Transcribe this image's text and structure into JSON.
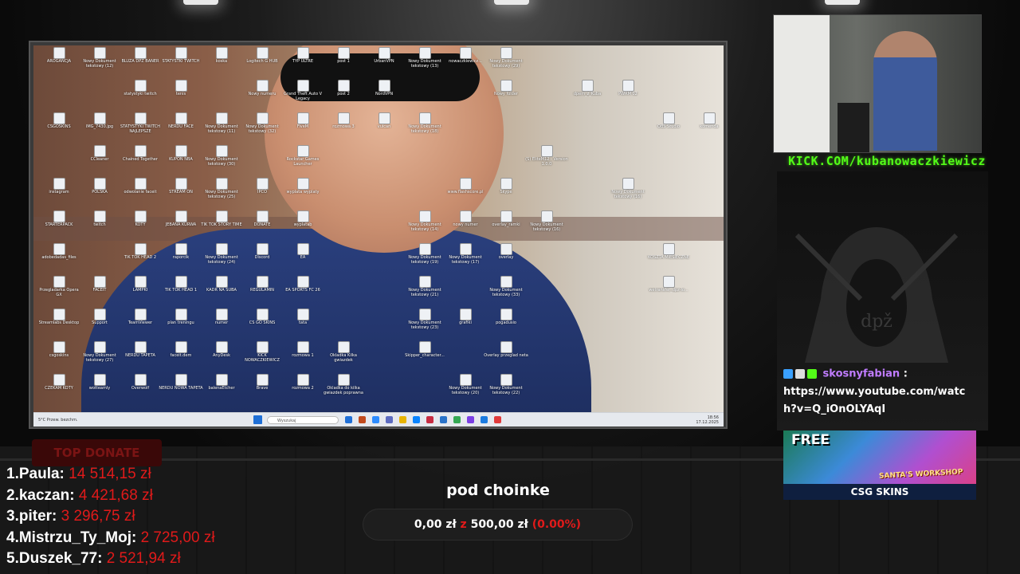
{
  "desktop": {
    "icons": [
      [
        "AROGANCJA",
        "Nowy Dokument tekstowy (12)",
        "BLUZA DPZ BANER",
        "STATYSTKI TWITCH",
        "koska",
        "Logitech G HUB",
        "TYP ULTRE",
        "post 1",
        "UrbanVPN",
        "Nowy Dokument tekstowy (13)",
        "nowaczkiewicz...",
        "Nowy Dokument tekstowy (29)"
      ],
      [
        "",
        "",
        "statystyki twitch",
        "tenis",
        "",
        "Nowy numeru",
        "Grand Theft Auto V Legacy",
        "post 2",
        "NordVPN",
        "",
        "",
        "Nowy folder",
        "",
        "dpem_z_Kuba",
        "PWRM 02"
      ],
      [
        "CSGOSKINS",
        "IMG_7430.jpg",
        "STATYSTYKI TWITCH NAJLEPSZE",
        "NERDU FACE",
        "Nowy Dokument tekstowy (11)",
        "Nowy Dokument tekstowy (32)",
        "FiveM",
        "rozmowa 3",
        "vulcan",
        "Nowy Dokument tekstowy (18)",
        "",
        "",
        "",
        "",
        "",
        "OBS Studio",
        "komenda"
      ],
      [
        "",
        "CCleaner",
        "Chained Together",
        "KUPON NBA",
        "Nowy Dokument tekstowy (30)",
        "",
        "Rockstar Games Launcher",
        "",
        "",
        "",
        "",
        "",
        "(S) EliteM12 - Version 1.0.0"
      ],
      [
        "instagram",
        "POLSKA",
        "odwolanie faceit",
        "STREAM ON",
        "Nowy Dokument tekstowy (25)",
        "IPCO",
        "wyplata wyplaty",
        "",
        "",
        "",
        "www.flashscore.pl",
        "Skype",
        "",
        "",
        "Nowy Dokument tekstowy (16)"
      ],
      [
        "STARTERPACK",
        "twitch",
        "KOTY",
        "JEBANA KURWA",
        "TIK TOK STORY TIME",
        "DONATE",
        "wyplatab",
        "",
        "",
        "Nowy Dokument tekstowy (14)",
        "nowy numer",
        "overlay_ramki",
        "Nowy Dokument tekstowy (16)"
      ],
      [
        "adobedadas_files",
        "",
        "TIK TOK HEAD 2",
        "raporcik",
        "Nowy Dokument tekstowy (24)",
        "Discord",
        "EA",
        "",
        "",
        "Nowy Dokument tekstowy (19)",
        "Nowy Dokument tekstowy (17)",
        "overlay",
        "",
        "",
        "",
        "KOSZTA MIESIECZNE"
      ],
      [
        "Przegladarka Opera GX",
        "FACEIT",
        "LAMPKI",
        "TIK TOK HEAD 1",
        "KADR NA SUBA",
        "REGULAMIN",
        "EA SPORTS FC 26",
        "",
        "",
        "Nowy Dokument tekstowy (21)",
        "",
        "Nowy Dokument tekstowy (33)",
        "",
        "",
        "",
        "wetransfer_dpz-lo..."
      ],
      [
        "Streamlabs Desktop",
        "Support",
        "TeamViewer",
        "plan treningu",
        "numer",
        "CS GO SKINS",
        "tata",
        "",
        "",
        "Nowy Dokument tekstowy (23)",
        "grafiki",
        "pogadusio"
      ],
      [
        "csgoskins",
        "Nowy Dokument tekstowy (27)",
        "NERDU TAPETA",
        "faceit.dem",
        "AnyDesk",
        "KICK NOWACZKIEWICZ",
        "rozmowa 1",
        "Okladka Kilka gwiazdek",
        "",
        "Skipper_character...",
        "",
        "Overlay przeglad neta"
      ],
      [
        "CZEKAM KOTY",
        "wotteamly",
        "Overwolf",
        "NERDU NOWA TAPETA",
        "balenaEtcher",
        "Brave",
        "rozmowa 2",
        "Okladka do kilka gwiazdek poprawna",
        "",
        "",
        "Nowy Dokument tekstowy (20)",
        "Nowy Dokument tekstowy (22)"
      ]
    ],
    "taskbar": {
      "weather_temp": "5°C",
      "weather_desc": "Przew. bezchm.",
      "search_placeholder": "Wyszukaj",
      "time": "18:56",
      "date": "17.12.2025",
      "apps": [
        "#1f6fd6",
        "#c14a1c",
        "#2d8cff",
        "#5c6bc0",
        "#e8b400",
        "#0a84ff",
        "#c72c41",
        "#2a73c9",
        "#35a853",
        "#7b3fe4",
        "#1b7be0",
        "#e03a3a"
      ]
    }
  },
  "stream": {
    "kick_url": "KICK.COM/kubanowaczkiewicz"
  },
  "chat": {
    "username": "skosnyfabian",
    "separator": ":",
    "message": "https://www.youtube.com/watch?v=Q_iOnOLYAqI",
    "badge_colors": [
      "#3aa0ff",
      "#dddddd",
      "#53fc18"
    ]
  },
  "promo": {
    "headline": "FREE",
    "subtitle": "SANTA'S WORKSHOP",
    "brand": "CSG SKINS"
  },
  "donations": {
    "header": "TOP DONATE",
    "entries": [
      {
        "rank": "1.",
        "name": "Paula:",
        "amount": "14 514,15 zł"
      },
      {
        "rank": "2.",
        "name": "kaczan:",
        "amount": "4 421,68 zł"
      },
      {
        "rank": "3.",
        "name": "piter:",
        "amount": "3 296,75 zł"
      },
      {
        "rank": "4.",
        "name": "Mistrzu_Ty_Moj:",
        "amount": "2 725,00 zł"
      },
      {
        "rank": "5.",
        "name": "Duszek_77:",
        "amount": "2 521,94 zł"
      }
    ]
  },
  "goal": {
    "title": "pod choinke",
    "current": "0,00 zł",
    "connector": "z",
    "target": "500,00 zł",
    "percent_label": "(0.00%)",
    "progress_fraction": 0.0
  },
  "colors": {
    "accent_red": "#e01a1a",
    "kick_green": "#53fc18",
    "chat_user": "#c07cff"
  }
}
